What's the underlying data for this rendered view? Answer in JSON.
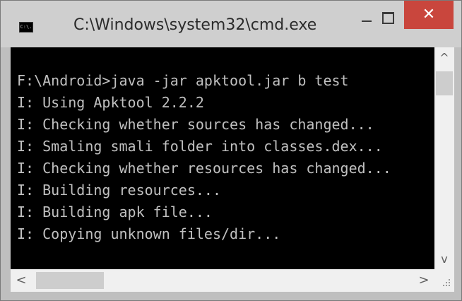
{
  "window": {
    "title": "C:\\Windows\\system32\\cmd.exe",
    "icon_label": "C:\\.",
    "close_symbol": "✕",
    "up_arrow": "^",
    "down_arrow": "v",
    "left_arrow": "<",
    "right_arrow": ">",
    "close_color": "#c9463d"
  },
  "console": {
    "lines": [
      "F:\\Android>java -jar apktool.jar b test",
      "I: Using Apktool 2.2.2",
      "I: Checking whether sources has changed...",
      "I: Smaling smali folder into classes.dex...",
      "I: Checking whether resources has changed...",
      "I: Building resources...",
      "I: Building apk file...",
      "I: Copying unknown files/dir..."
    ],
    "background": "#000000",
    "text_color": "#c0c0c0"
  },
  "icons": {
    "app": "cmd-app-icon",
    "minimize": "minimize-icon",
    "maximize": "maximize-icon",
    "close": "close-icon"
  }
}
